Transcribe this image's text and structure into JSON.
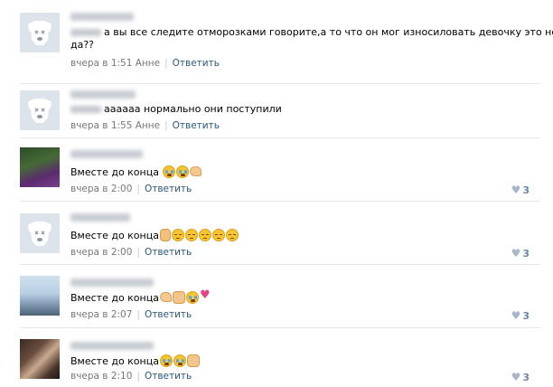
{
  "comments": [
    {
      "avatar": "default-dog-avatar",
      "text": "а вы все следите отморозками говорите,а то что он мог износиловать девочку это норм",
      "text2": "да??",
      "emojis": [],
      "meta": "вчера в 1:51 Анне",
      "reply": "Ответить",
      "likes": ""
    },
    {
      "avatar": "default-dog-avatar",
      "text": "аааааа нормально они поступили",
      "text2": "",
      "emojis": [],
      "meta": "вчера в 1:55 Анне",
      "reply": "Ответить",
      "likes": ""
    },
    {
      "avatar": "photo-avatar",
      "text": "Вместе до конца",
      "text2": "",
      "emojis": [
        "crying-emoji",
        "crying-emoji",
        "flexed-biceps-emoji"
      ],
      "meta": "вчера в 2:00",
      "reply": "Ответить",
      "likes": "3"
    },
    {
      "avatar": "default-dog-avatar",
      "text": "Вместе до конца",
      "text2": "",
      "emojis": [
        "raised-hand-emoji",
        "pensive-emoji",
        "pensive-emoji",
        "pensive-emoji",
        "pensive-emoji",
        "pensive-emoji"
      ],
      "meta": "вчера в 2:00",
      "reply": "Ответить",
      "likes": "3"
    },
    {
      "avatar": "photo-avatar",
      "text": "Вместе до конца",
      "text2": "",
      "emojis": [
        "flexed-biceps-emoji",
        "fist-emoji",
        "crying-emoji",
        "heart-emoji"
      ],
      "meta": "вчера в 2:07",
      "reply": "Ответить",
      "likes": "3"
    },
    {
      "avatar": "photo-avatar",
      "text": "Вместе до конца",
      "text2": "",
      "emojis": [
        "crying-emoji",
        "crying-emoji",
        "fist-emoji"
      ],
      "meta": "вчера в 2:10",
      "reply": "Ответить",
      "likes": "3"
    }
  ],
  "colors": {
    "link": "#2b587a",
    "meta": "#777777",
    "likes": "#6a86a6",
    "separator": "#e4e8ec",
    "default_avatar_bg": "#dde3ea"
  }
}
